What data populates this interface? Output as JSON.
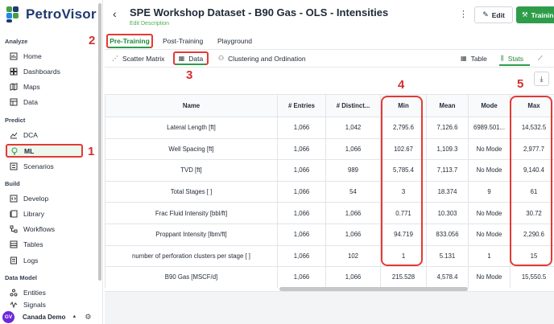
{
  "app": {
    "logo_text": "PetroVisor"
  },
  "sidebar": {
    "sections": [
      {
        "title": "Analyze",
        "items": [
          {
            "label": "Home",
            "icon": "home-icon"
          },
          {
            "label": "Dashboards",
            "icon": "dashboard-icon"
          },
          {
            "label": "Maps",
            "icon": "map-icon"
          },
          {
            "label": "Data",
            "icon": "data-icon"
          }
        ]
      },
      {
        "title": "Predict",
        "items": [
          {
            "label": "DCA",
            "icon": "trend-icon"
          },
          {
            "label": "ML",
            "icon": "lightbulb-icon"
          },
          {
            "label": "Scenarios",
            "icon": "scenarios-icon"
          }
        ]
      },
      {
        "title": "Build",
        "items": [
          {
            "label": "Develop",
            "icon": "code-icon"
          },
          {
            "label": "Library",
            "icon": "library-icon"
          },
          {
            "label": "Workflows",
            "icon": "workflow-icon"
          },
          {
            "label": "Tables",
            "icon": "table-icon"
          },
          {
            "label": "Logs",
            "icon": "logs-icon"
          }
        ]
      },
      {
        "title": "Data Model",
        "items": [
          {
            "label": "Entities",
            "icon": "entities-icon"
          },
          {
            "label": "Signals",
            "icon": "signals-icon"
          }
        ]
      }
    ],
    "user": {
      "initials": "GV",
      "name": "Canada Demo"
    }
  },
  "annotations": [
    "1",
    "2",
    "3",
    "4",
    "5"
  ],
  "header": {
    "title": "SPE Workshop Dataset - B90 Gas - OLS - Intensities",
    "edit_description": "Edit Description",
    "edit_label": "Edit",
    "train_label": "Training"
  },
  "tabs": {
    "primary": [
      "Pre-Training",
      "Post-Training",
      "Playground"
    ],
    "secondary": [
      "Scatter Matrix",
      "Data",
      "Clustering and Ordination"
    ],
    "views": [
      "Table",
      "Stats"
    ]
  },
  "table": {
    "columns": [
      "Name",
      "# Entries",
      "# Distinct...",
      "Min",
      "Mean",
      "Mode",
      "Max"
    ],
    "rows": [
      [
        "Lateral Length [ft]",
        "1,066",
        "1,042",
        "2,795.6",
        "7,126.6",
        "6989.501...",
        "14,532.5"
      ],
      [
        "Well Spacing [ft]",
        "1,066",
        "1,066",
        "102.67",
        "1,109.3",
        "No Mode",
        "2,977.7"
      ],
      [
        "TVD [ft]",
        "1,066",
        "989",
        "5,785.4",
        "7,113.7",
        "No Mode",
        "9,140.4"
      ],
      [
        "Total Stages [ ]",
        "1,066",
        "54",
        "3",
        "18.374",
        "9",
        "61"
      ],
      [
        "Frac Fluid Intensity [bbl/ft]",
        "1,066",
        "1,066",
        "0.771",
        "10.303",
        "No Mode",
        "30.72"
      ],
      [
        "Proppant Intensity [lbm/ft]",
        "1,066",
        "1,066",
        "94.719",
        "833.056",
        "No Mode",
        "2,290.6"
      ],
      [
        "number of perforation clusters per stage [ ]",
        "1,066",
        "102",
        "1",
        "5.131",
        "1",
        "15"
      ],
      [
        "B90 Gas [MSCF/d]",
        "1,066",
        "1,066",
        "215.528",
        "4,578.4",
        "No Mode",
        "15,550.5"
      ]
    ]
  },
  "colors": {
    "accent_green": "#2e9d4a",
    "annotation_red": "#e53935",
    "logo_blue": "#1e3a6e"
  }
}
